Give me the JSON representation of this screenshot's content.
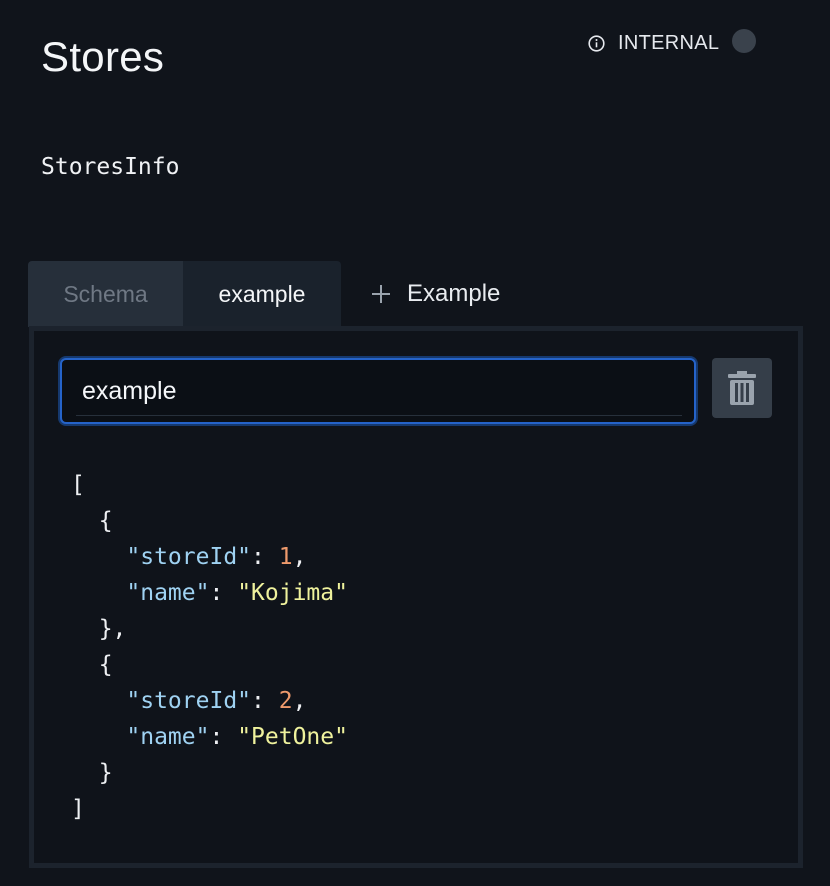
{
  "header": {
    "title": "Stores",
    "badge_label": "INTERNAL"
  },
  "description": "StoresInfo",
  "tabs": {
    "schema_label": "Schema",
    "example_label": "example",
    "add_label": "Example"
  },
  "example_panel": {
    "name_value": "example",
    "code_lines": [
      [
        {
          "t": "punc",
          "v": "["
        }
      ],
      [
        {
          "t": "punc",
          "v": "  {"
        }
      ],
      [
        {
          "t": "punc",
          "v": "    "
        },
        {
          "t": "key",
          "v": "\"storeId\""
        },
        {
          "t": "punc",
          "v": ": "
        },
        {
          "t": "num",
          "v": "1"
        },
        {
          "t": "punc",
          "v": ","
        }
      ],
      [
        {
          "t": "punc",
          "v": "    "
        },
        {
          "t": "key",
          "v": "\"name\""
        },
        {
          "t": "punc",
          "v": ": "
        },
        {
          "t": "str",
          "v": "\"Kojima\""
        }
      ],
      [
        {
          "t": "punc",
          "v": "  },"
        }
      ],
      [
        {
          "t": "punc",
          "v": "  {"
        }
      ],
      [
        {
          "t": "punc",
          "v": "    "
        },
        {
          "t": "key",
          "v": "\"storeId\""
        },
        {
          "t": "punc",
          "v": ": "
        },
        {
          "t": "num",
          "v": "2"
        },
        {
          "t": "punc",
          "v": ","
        }
      ],
      [
        {
          "t": "punc",
          "v": "    "
        },
        {
          "t": "key",
          "v": "\"name\""
        },
        {
          "t": "punc",
          "v": ": "
        },
        {
          "t": "str",
          "v": "\"PetOne\""
        }
      ],
      [
        {
          "t": "punc",
          "v": "  }"
        }
      ],
      [
        {
          "t": "punc",
          "v": "]"
        }
      ]
    ]
  },
  "icons": {
    "info": "info-circle-icon",
    "plus": "plus-icon",
    "trash": "trash-icon"
  },
  "colors": {
    "background": "#10141b",
    "accent": "#2563c9",
    "json_key": "#9fd2f2",
    "json_number": "#ee9a6c",
    "json_string": "#eff29d"
  }
}
